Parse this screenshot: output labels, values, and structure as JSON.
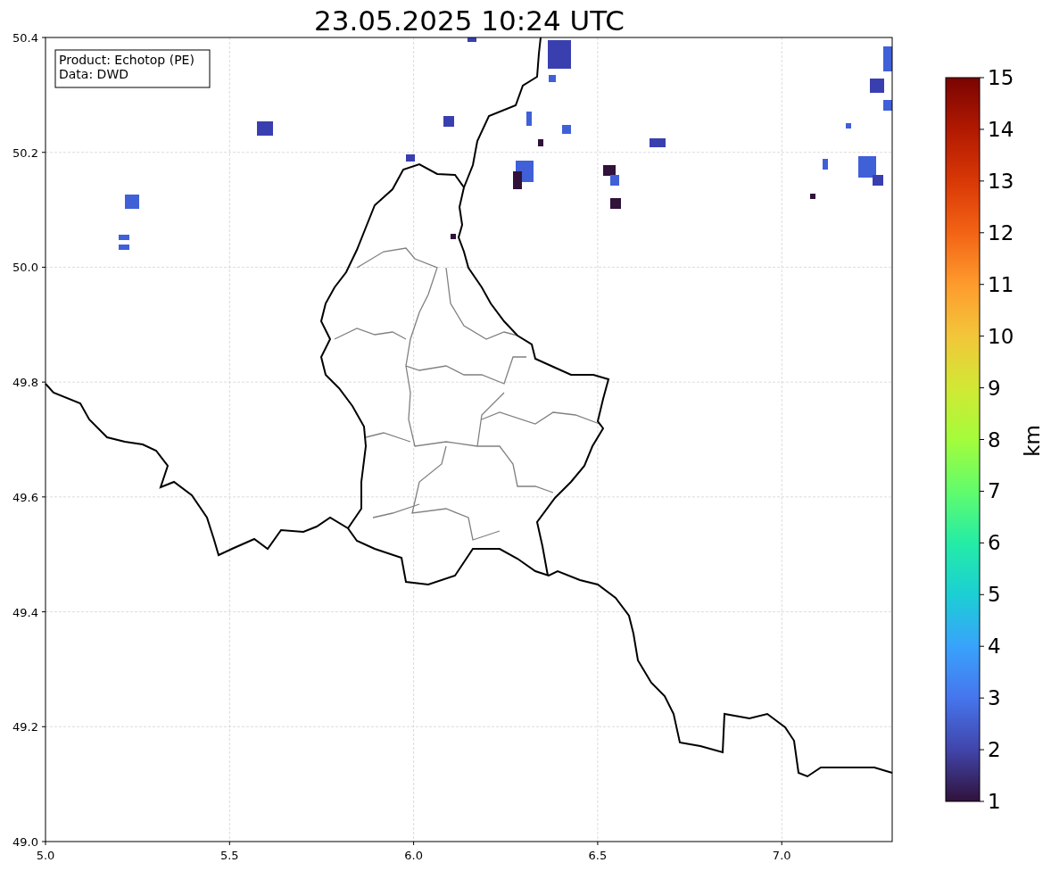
{
  "title": "23.05.2025 10:24 UTC",
  "info_box": {
    "lines": [
      "Product: Echotop (PE)",
      "Data: DWD"
    ]
  },
  "x_axis": {
    "ticks": [
      "5.0",
      "5.5",
      "6.0",
      "6.5",
      "7.0"
    ]
  },
  "y_axis": {
    "ticks": [
      "50.4",
      "50.2",
      "50.0",
      "49.8",
      "49.6",
      "49.4",
      "49.2",
      "49.0"
    ]
  },
  "colorbar": {
    "label": "km",
    "ticks": [
      "15",
      "14",
      "13",
      "12",
      "11",
      "10",
      "9",
      "8",
      "7",
      "6",
      "5",
      "4",
      "3",
      "2",
      "1"
    ]
  }
}
